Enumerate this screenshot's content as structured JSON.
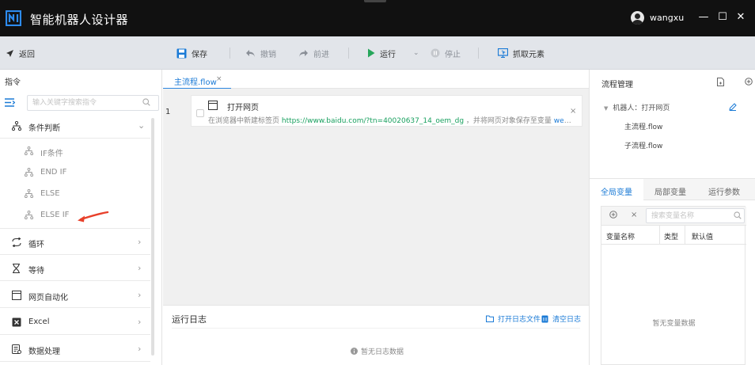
{
  "app": {
    "title": "智能机器人设计器",
    "username": "wangxu"
  },
  "window_controls": {
    "minimize": "—",
    "maximize": "☐",
    "close": "✕"
  },
  "toolbar": {
    "back": "返回",
    "save": "保存",
    "undo": "撤销",
    "redo": "前进",
    "run": "运行",
    "stop": "停止",
    "capture": "抓取元素"
  },
  "left_panel": {
    "header": "指令",
    "search_placeholder": "输入关键字搜索指令",
    "categories": [
      {
        "label": "条件判断",
        "icon": "branch-icon",
        "expanded": true,
        "children": [
          "IF条件",
          "END IF",
          "ELSE",
          "ELSE IF"
        ]
      },
      {
        "label": "循环",
        "icon": "loop-icon"
      },
      {
        "label": "等待",
        "icon": "hourglass-icon"
      },
      {
        "label": "网页自动化",
        "icon": "browser-icon"
      },
      {
        "label": "Excel",
        "icon": "excel-icon"
      },
      {
        "label": "数据处理",
        "icon": "data-icon"
      }
    ]
  },
  "editor": {
    "tab": {
      "label": "主流程.flow",
      "close": "×"
    },
    "steps": [
      {
        "line": "1",
        "title": "打开网页",
        "desc_prefix": "在浏览器中新建标签页 ",
        "desc_url": "https://www.baidu.com/?tn=40020637_14_oem_dg",
        "desc_middle": " ，并将网页对象保存至变量 ",
        "desc_var": "web_a...",
        "close": "×"
      }
    ]
  },
  "log_panel": {
    "title": "运行日志",
    "open_file": "打开日志文件",
    "clear": "清空日志",
    "empty": "暂无日志数据"
  },
  "right_panel": {
    "title": "流程管理",
    "tree_root": "机器人：打开网页",
    "tree_items": [
      "主流程.flow",
      "子流程.flow"
    ],
    "tabs": [
      "全局变量",
      "局部变量",
      "运行参数"
    ],
    "var_del": "×",
    "var_search_placeholder": "搜索变量名称",
    "columns": [
      "变量名称",
      "类型",
      "默认值"
    ],
    "empty": "暂无变量数据"
  },
  "colors": {
    "title_bar": "#111111",
    "toolbar": "#e2e5ea",
    "accent_blue": "#1a7ad6",
    "run_green": "#26a65b",
    "url_green": "#19a05f",
    "arrow_red": "#e8402a"
  }
}
